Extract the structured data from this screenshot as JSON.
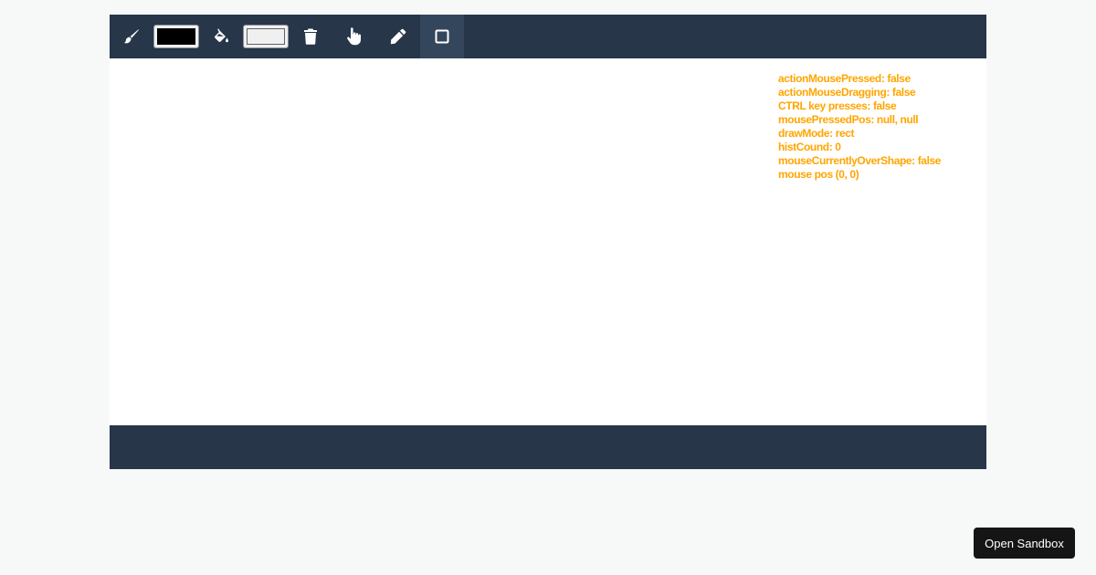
{
  "toolbar": {
    "tools": [
      {
        "id": "brush",
        "icon": "brush-icon"
      },
      {
        "id": "stroke-color",
        "color": "#000000"
      },
      {
        "id": "fill",
        "icon": "paint-bucket-icon"
      },
      {
        "id": "fill-color",
        "color": "#f0f0f0"
      },
      {
        "id": "delete",
        "icon": "trash-icon"
      },
      {
        "id": "select",
        "icon": "hand-pointer-icon"
      },
      {
        "id": "pencil",
        "icon": "pencil-icon"
      },
      {
        "id": "rect",
        "icon": "square-icon",
        "active": true
      }
    ]
  },
  "debug": {
    "lines": [
      "actionMousePressed: false",
      "actionMouseDragging: false",
      "CTRL key presses: false",
      "mousePressedPos: null, null",
      "drawMode: rect",
      "histCound: 0",
      "mouseCurrentlyOverShape: false",
      "mouse pos (0, 0)"
    ]
  },
  "sandbox": {
    "label": "Open Sandbox"
  },
  "colors": {
    "toolbar_bg": "#273649",
    "debug_text": "#ffa500",
    "canvas_bg": "#ffffff"
  }
}
